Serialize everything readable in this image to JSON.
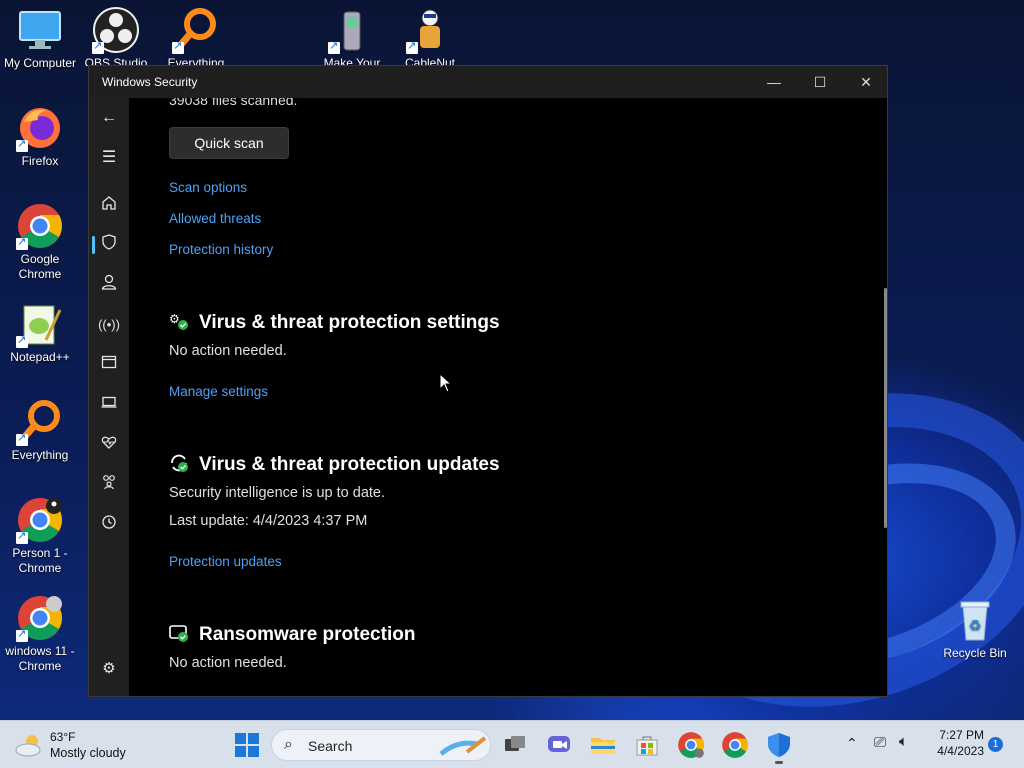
{
  "desktop": {
    "icons": [
      {
        "label": "My Computer"
      },
      {
        "label": "OBS Studio"
      },
      {
        "label": "Everything"
      },
      {
        "label": "Make Your"
      },
      {
        "label": "CableNut"
      },
      {
        "label": "Firefox"
      },
      {
        "label": "Google Chrome"
      },
      {
        "label": "Notepad++"
      },
      {
        "label": "Everything"
      },
      {
        "label": "Person 1 - Chrome"
      },
      {
        "label": "windows 11 - Chrome"
      },
      {
        "label": "Recycle Bin"
      }
    ]
  },
  "window": {
    "title": "Windows Security",
    "files_scanned": "39038 files scanned.",
    "quick_scan_label": "Quick scan",
    "links": {
      "scan_options": "Scan options",
      "allowed_threats": "Allowed threats",
      "protection_history": "Protection history"
    },
    "settings_section": {
      "title": "Virus & threat protection settings",
      "status": "No action needed.",
      "link": "Manage settings"
    },
    "updates_section": {
      "title": "Virus & threat protection updates",
      "status": "Security intelligence is up to date.",
      "last_update": "Last update: 4/4/2023 4:37 PM",
      "link": "Protection updates"
    },
    "ransomware_section": {
      "title": "Ransomware protection",
      "status": "No action needed."
    }
  },
  "taskbar": {
    "weather_temp": "63°F",
    "weather_desc": "Mostly cloudy",
    "search_label": "Search",
    "time": "7:27 PM",
    "date": "4/4/2023",
    "notification_count": "1"
  },
  "colors": {
    "link": "#4ea1f3",
    "nav_active": "#4cc2ff",
    "window_bg": "#000000",
    "nav_bg": "#202020"
  }
}
